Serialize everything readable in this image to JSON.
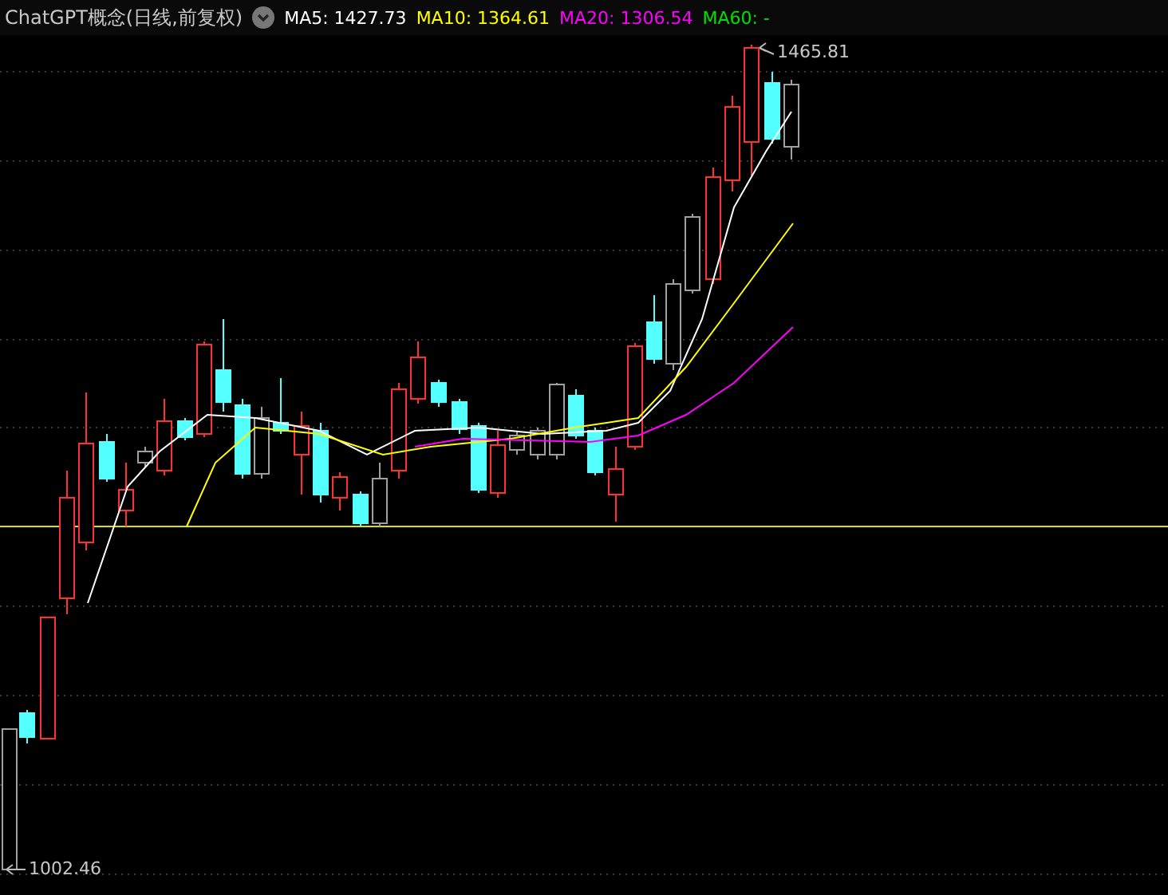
{
  "header": {
    "title": "ChatGPT概念(日线,前复权)",
    "indicators": [
      {
        "label": "MA5: 1427.73",
        "color": "#ffffff"
      },
      {
        "label": "MA10: 1364.61",
        "color": "#ffff00"
      },
      {
        "label": "MA20: 1306.54",
        "color": "#ff00ff"
      },
      {
        "label": "MA60: -",
        "color": "#00e000"
      }
    ]
  },
  "chart": {
    "high_label": "1465.81",
    "low_label": "1002.46"
  }
}
